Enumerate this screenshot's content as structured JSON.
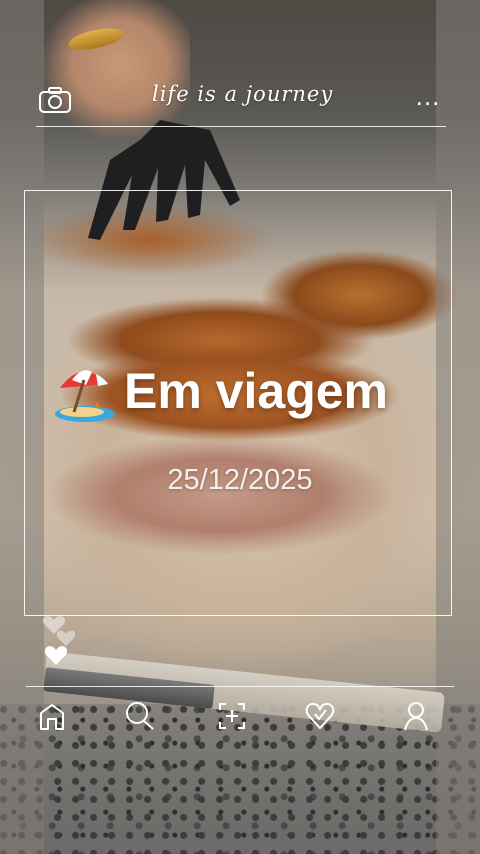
{
  "header": {
    "tagline": "life is a journey",
    "more_label": "…"
  },
  "card": {
    "emoji": "beach-umbrella-icon",
    "title": "Em viagem",
    "date": "25/12/2025"
  },
  "reactions": {
    "icons": [
      "heart-outline-icon",
      "heart-filled-icon"
    ]
  },
  "bottom_nav": {
    "items": [
      {
        "icon": "home-icon"
      },
      {
        "icon": "search-icon"
      },
      {
        "icon": "add-icon"
      },
      {
        "icon": "heart-icon"
      },
      {
        "icon": "profile-icon"
      }
    ]
  },
  "colors": {
    "overlay_text": "#ffffff",
    "date_text": "#f3efea"
  }
}
